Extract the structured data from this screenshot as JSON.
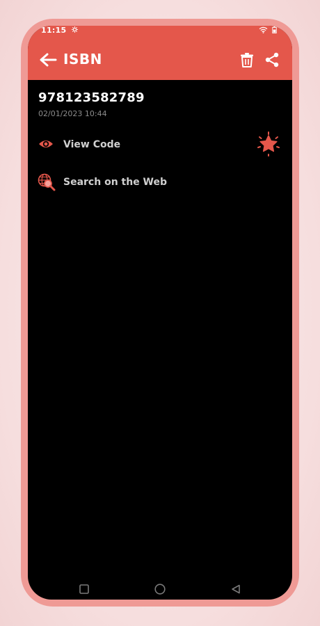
{
  "status_bar": {
    "time": "11:15"
  },
  "header": {
    "title": "ISBN",
    "back_icon": "back-arrow-icon",
    "delete_icon": "trash-icon",
    "share_icon": "share-icon"
  },
  "item": {
    "code": "978123582789",
    "date": "02/01/2023 10:44"
  },
  "actions": [
    {
      "label": "View Code",
      "icon": "eye-icon"
    },
    {
      "label": "Search on the Web",
      "icon": "globe-search-icon"
    }
  ],
  "favorite": {
    "icon": "star-icon"
  },
  "colors": {
    "accent": "#e4574b",
    "frame": "#ef9a95",
    "background": "#000000"
  },
  "nav": {
    "buttons": [
      "recents-icon",
      "home-icon",
      "back-icon"
    ]
  }
}
